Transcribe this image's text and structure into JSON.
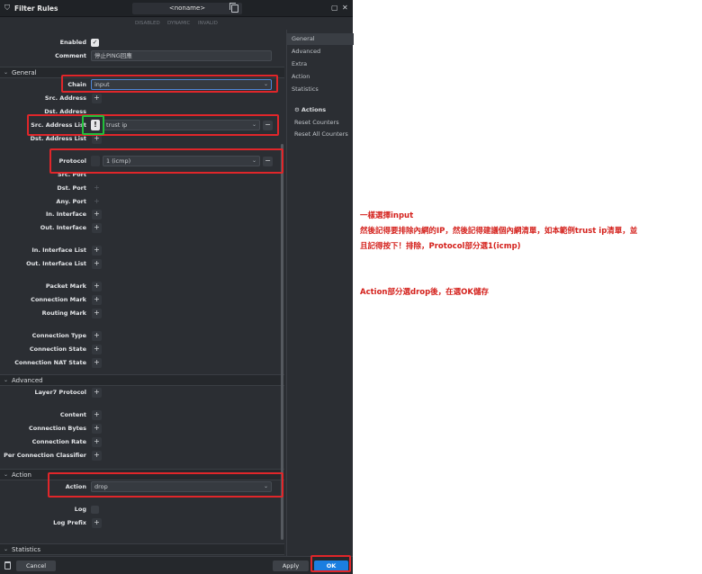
{
  "window": {
    "title": "Filter Rules",
    "name": "<noname>",
    "status": [
      "DISABLED",
      "DYNAMIC",
      "INVALID"
    ]
  },
  "form": {
    "enabled_label": "Enabled",
    "comment_label": "Comment",
    "comment_value": "停止PING回應",
    "sections": {
      "general": "General",
      "advanced": "Advanced",
      "action": "Action",
      "statistics": "Statistics"
    },
    "chain_label": "Chain",
    "chain_value": "input",
    "src_address_label": "Src. Address",
    "dst_address_label": "Dst. Address",
    "src_address_list_label": "Src. Address List",
    "src_address_list_value": "trust ip",
    "invert_symbol": "!",
    "dst_address_list_label": "Dst. Address List",
    "protocol_label": "Protocol",
    "protocol_value": "1 (icmp)",
    "src_port_label": "Src. Port",
    "dst_port_label": "Dst. Port",
    "any_port_label": "Any. Port",
    "in_interface_label": "In. Interface",
    "out_interface_label": "Out. Interface",
    "in_interface_list_label": "In. Interface List",
    "out_interface_list_label": "Out. Interface List",
    "packet_mark_label": "Packet Mark",
    "connection_mark_label": "Connection Mark",
    "routing_mark_label": "Routing Mark",
    "connection_type_label": "Connection Type",
    "connection_state_label": "Connection State",
    "connection_nat_state_label": "Connection NAT State",
    "layer7_label": "Layer7 Protocol",
    "content_label": "Content",
    "connection_bytes_label": "Connection Bytes",
    "connection_rate_label": "Connection Rate",
    "per_connection_classifier_label": "Per Connection Classifier",
    "action_label": "Action",
    "action_value": "drop",
    "log_label": "Log",
    "log_prefix_label": "Log Prefix",
    "plus": "+",
    "minus": "−"
  },
  "sidebar": {
    "items": [
      "General",
      "Advanced",
      "Extra",
      "Action",
      "Statistics"
    ],
    "actions_header": "Actions",
    "reset_counters": "Reset Counters",
    "reset_all_counters": "Reset All Counters"
  },
  "buttons": {
    "cancel": "Cancel",
    "apply": "Apply",
    "ok": "OK"
  },
  "annotations": {
    "line1": "一樣選擇input",
    "line2": "然後記得要排除內網的IP，然後記得建議個內網清單，如本範例trust ip清單，並",
    "line3": "且記得按下！排除，Protocol部分選1(icmp)",
    "line4": "Action部分選drop後，在選OK儲存"
  },
  "colors": {
    "window_bg": "#2b2e33",
    "accent": "#1b7ee0",
    "highlight_red": "#e0262a",
    "highlight_green": "#22c03a"
  }
}
